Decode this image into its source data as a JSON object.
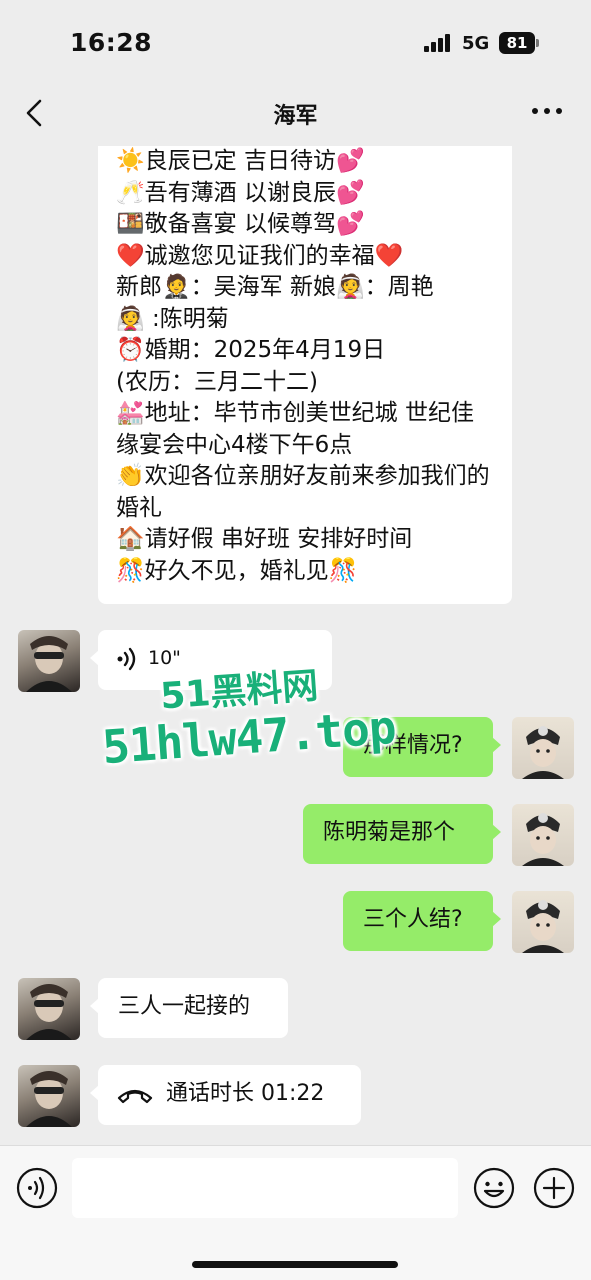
{
  "status_bar": {
    "time": "16:28",
    "network": "5G",
    "battery": "81"
  },
  "nav": {
    "title": "海军",
    "back_icon": "chevron-left-icon",
    "more_icon": "more-dots-icon"
  },
  "invite": {
    "lines": [
      "☀️良辰已定 吉日待访💕",
      "🥂吾有薄酒 以谢良辰💕",
      "🍱敬备喜宴 以候尊驾💕",
      "❤️诚邀您见证我们的幸福❤️",
      "新郎🤵：吴海军  新娘👰：周艳",
      "👰 :陈明菊",
      "⏰婚期：2025年4月19日",
      "(农历：三月二十二)",
      "💒地址：毕节市创美世纪城  世纪佳缘宴会中心4楼下午6点",
      "👏欢迎各位亲朋好友前来参加我们的婚礼",
      "🏠请好假 串好班 安排好时间",
      "🎊好久不见，婚礼见🎊"
    ]
  },
  "messages": [
    {
      "side": "left",
      "type": "voice",
      "duration": "10\""
    },
    {
      "side": "right",
      "type": "text",
      "text": "那样情况?"
    },
    {
      "side": "right",
      "type": "text",
      "text": "陈明菊是那个"
    },
    {
      "side": "right",
      "type": "text",
      "text": "三个人结?"
    },
    {
      "side": "left",
      "type": "text",
      "text": "三人一起接的"
    },
    {
      "side": "left",
      "type": "call",
      "text": "通话时长 01:22"
    }
  ],
  "watermark": {
    "line1": "51黑料网",
    "line2": "51hlw47.top"
  },
  "input_bar": {
    "voice_icon": "voice-input-icon",
    "emoji_icon": "emoji-icon",
    "plus_icon": "plus-circle-icon",
    "placeholder": ""
  },
  "colors": {
    "background": "#ededed",
    "sent_bubble": "#95ec69",
    "received_bubble": "#ffffff",
    "watermark": "#19b079"
  }
}
